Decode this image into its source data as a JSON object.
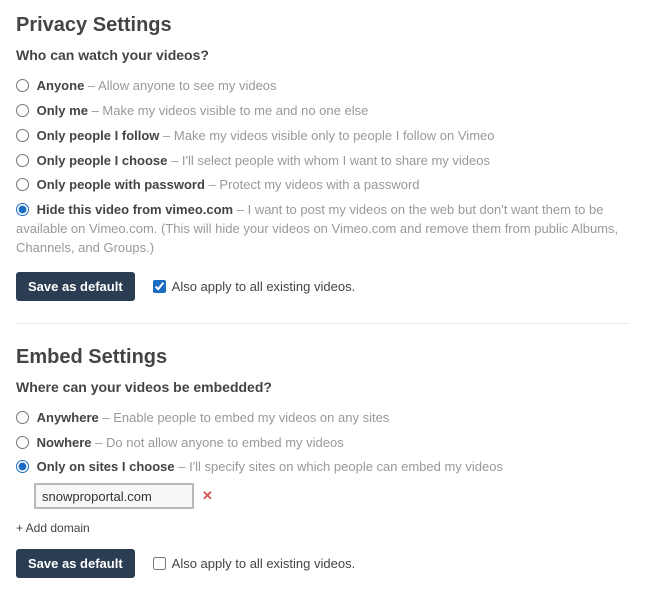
{
  "privacy": {
    "title": "Privacy Settings",
    "subtitle": "Who can watch your videos?",
    "options": [
      {
        "label": "Anyone",
        "desc": "Allow anyone to see my videos"
      },
      {
        "label": "Only me",
        "desc": "Make my videos visible to me and no one else"
      },
      {
        "label": "Only people I follow",
        "desc": "Make my videos visible only to people I follow on Vimeo"
      },
      {
        "label": "Only people I choose",
        "desc": "I'll select people with whom I want to share my videos"
      },
      {
        "label": "Only people with password",
        "desc": "Protect my videos with a password"
      },
      {
        "label": "Hide this video from vimeo.com",
        "desc": "I want to post my videos on the web but don't want them to be available on Vimeo.com. (This will hide your videos on Vimeo.com and remove them from public Albums, Channels, and Groups.)"
      }
    ],
    "selected_index": 5,
    "save_label": "Save as default",
    "apply_label": "Also apply to all existing videos.",
    "apply_checked": true
  },
  "embed": {
    "title": "Embed Settings",
    "subtitle": "Where can your videos be embedded?",
    "options": [
      {
        "label": "Anywhere",
        "desc": "Enable people to embed my videos on any sites"
      },
      {
        "label": "Nowhere",
        "desc": "Do not allow anyone to embed my videos"
      },
      {
        "label": "Only on sites I choose",
        "desc": "I'll specify sites on which people can embed my videos"
      }
    ],
    "selected_index": 2,
    "domain_value": "snowproportal.com",
    "remove_icon": "✕",
    "add_domain_label": "+ Add domain",
    "save_label": "Save as default",
    "apply_label": "Also apply to all existing videos.",
    "apply_checked": false
  }
}
